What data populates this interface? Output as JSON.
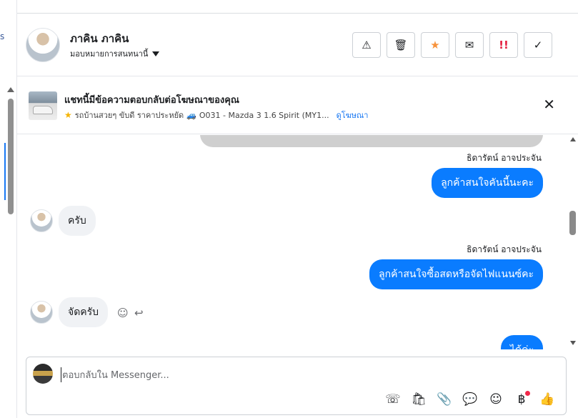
{
  "left_panel": {
    "peek_text": "s"
  },
  "header": {
    "contact_name": "ภาคิน ภาคิน",
    "assign_label": "มอบหมายการสนทนานี้",
    "actions": [
      {
        "icon": "warning-icon",
        "glyph": "⚠"
      },
      {
        "icon": "trash-icon",
        "glyph": "🗑"
      },
      {
        "icon": "star-icon",
        "glyph": "★",
        "color": "#f7923b"
      },
      {
        "icon": "mail-icon",
        "glyph": "✉"
      },
      {
        "icon": "important-icon",
        "glyph": "!!",
        "color": "#e41e3f"
      },
      {
        "icon": "check-icon",
        "glyph": "✓"
      }
    ]
  },
  "ad_banner": {
    "title": "แชทนี้มีข้อความตอบกลับต่อโฆษณาของคุณ",
    "description": "รถบ้านสวยๆ ขับดี ราคาประหยัด",
    "car_text": "O031 - Mazda 3 1.6 Spirit (MY1...",
    "view_ad_label": "ดูโฆษณา",
    "close_glyph": "✕"
  },
  "messages": [
    {
      "direction": "out",
      "sender": "ธิดารัตน์ อาจประจัน",
      "text": "ลูกค้าสนใจคันนี้นะคะ"
    },
    {
      "direction": "in",
      "text": "ครับ"
    },
    {
      "direction": "out",
      "sender": "ธิดารัตน์ อาจประจัน",
      "text": "ลูกค้าสนใจซื้อสดหรือจัดไฟแนนซ์คะ"
    },
    {
      "direction": "in",
      "text": "จัดครับ"
    },
    {
      "direction": "out",
      "text": "ได้ค่ะ"
    }
  ],
  "composer": {
    "placeholder": "ตอบกลับใน Messenger...",
    "tools": [
      {
        "icon": "call-add-icon",
        "glyph": "☏"
      },
      {
        "icon": "shopping-bag-icon",
        "glyph": "🛍"
      },
      {
        "icon": "attachment-icon",
        "glyph": "📎"
      },
      {
        "icon": "chat-bubble-icon",
        "glyph": "💬"
      },
      {
        "icon": "emoji-icon",
        "glyph": "☺"
      },
      {
        "icon": "baht-payment-icon",
        "glyph": "฿"
      },
      {
        "icon": "thumbs-up-icon",
        "glyph": "👍"
      }
    ]
  },
  "colors": {
    "accent": "#0a7cff",
    "incoming_bubble": "#f0f2f5"
  }
}
